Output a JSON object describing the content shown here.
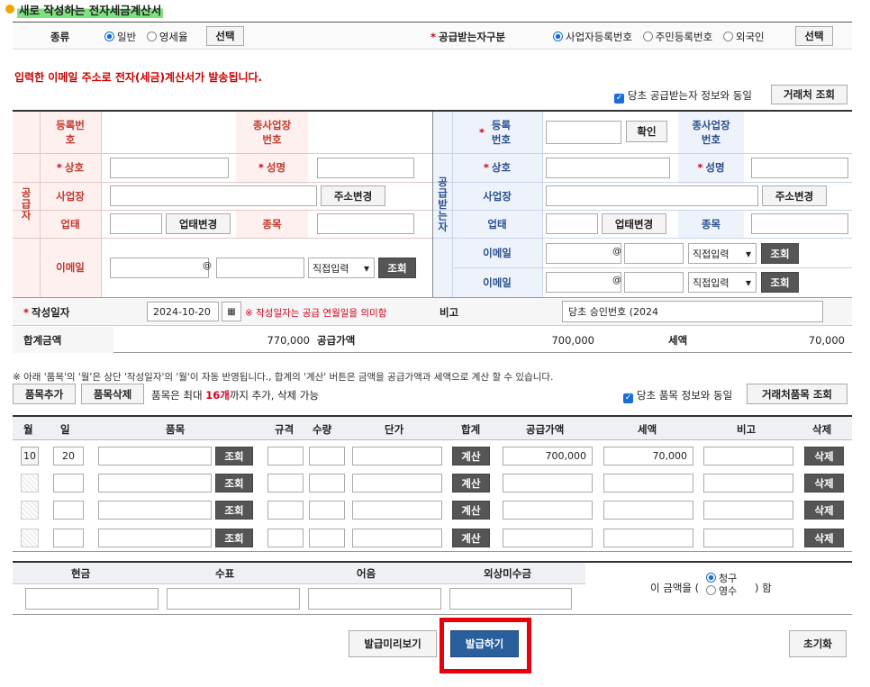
{
  "page_title": "새로 작성하는 전자세금계산서",
  "kind": {
    "label": "종류",
    "options": [
      "일반",
      "영세율"
    ],
    "selected": "일반",
    "select_btn": "선택"
  },
  "receiver_type": {
    "label": "공급받는자구분",
    "options": [
      "사업자등록번호",
      "주민등록번호",
      "외국인"
    ],
    "selected": "사업자등록번호",
    "select_btn": "선택"
  },
  "email_notice": "입력한 이메일 주소로 전자(세금)계산서가 발송됩니다.",
  "same_receiver": {
    "label": "당초 공급받는자 정보와 동일",
    "checked": true
  },
  "client_lookup_btn": "거래처 조회",
  "supplier": {
    "side_label": "공급자",
    "reg_no": "등록번호",
    "sub_biz": "종사업장번호",
    "company": "상호",
    "name": "성명",
    "address": "사업장",
    "change_addr_btn": "주소변경",
    "biz_type": "업태",
    "change_biz_btn": "업태변경",
    "item": "종목",
    "email": "이메일",
    "at": "@",
    "direct_input": "직접입력",
    "lookup_btn": "조회"
  },
  "receiver": {
    "side_label": "공급받는자",
    "reg_no": "등록번호",
    "confirm_btn": "확인",
    "sub_biz": "종사업장번호",
    "company": "상호",
    "name": "성명",
    "address": "사업장",
    "change_addr_btn": "주소변경",
    "biz_type": "업태",
    "change_biz_btn": "업태변경",
    "item": "종목",
    "email": "이메일",
    "at": "@",
    "direct_input": "직접입력",
    "lookup_btn": "조회"
  },
  "write_date": {
    "label": "작성일자",
    "value": "2024-10-20",
    "note": "※ 작성일자는 공급 연월일을 의미함"
  },
  "remark": {
    "label": "비고",
    "value": "당초 승인번호 (2024"
  },
  "totals": {
    "total_label": "합계금액",
    "total": "770,000",
    "supply_label": "공급가액",
    "supply": "700,000",
    "tax_label": "세액",
    "tax": "70,000"
  },
  "items_notice": "※ 아래 '품목'의 '월'은 상단 '작성일자'의 '월'이 자동 반영됩니다., 합계의 '계산' 버튼은 금액을 공급가액과 세액으로 계산 할 수 있습니다.",
  "add_item_btn": "품목추가",
  "del_item_btn": "품목삭제",
  "item_limit_pre": "품목은 최대 ",
  "item_limit_num": "16개",
  "item_limit_post": "까지 추가, 삭제 가능",
  "same_items": {
    "label": "당초 품목 정보와 동일",
    "checked": true
  },
  "client_items_btn": "거래처품목 조회",
  "item_table": {
    "headers": [
      "월",
      "일",
      "품목",
      "규격",
      "수량",
      "단가",
      "합계",
      "공급가액",
      "세액",
      "비고",
      "삭제"
    ],
    "lookup_btn": "조회",
    "calc_btn": "계산",
    "delete_btn": "삭제",
    "rows": [
      {
        "month": "10",
        "day": "20",
        "supply": "700,000",
        "tax": "70,000"
      },
      {
        "month": "",
        "day": "",
        "supply": "",
        "tax": ""
      },
      {
        "month": "",
        "day": "",
        "supply": "",
        "tax": ""
      },
      {
        "month": "",
        "day": "",
        "supply": "",
        "tax": ""
      }
    ]
  },
  "payment": {
    "headers": [
      "현금",
      "수표",
      "어음",
      "외상미수금"
    ],
    "amount_pre": "이 금액을 (",
    "amount_post": ") 함",
    "options": [
      "청구",
      "영수"
    ],
    "selected": "청구"
  },
  "footer": {
    "preview_btn": "발급미리보기",
    "issue_btn": "발급하기",
    "reset_btn": "초기화"
  }
}
